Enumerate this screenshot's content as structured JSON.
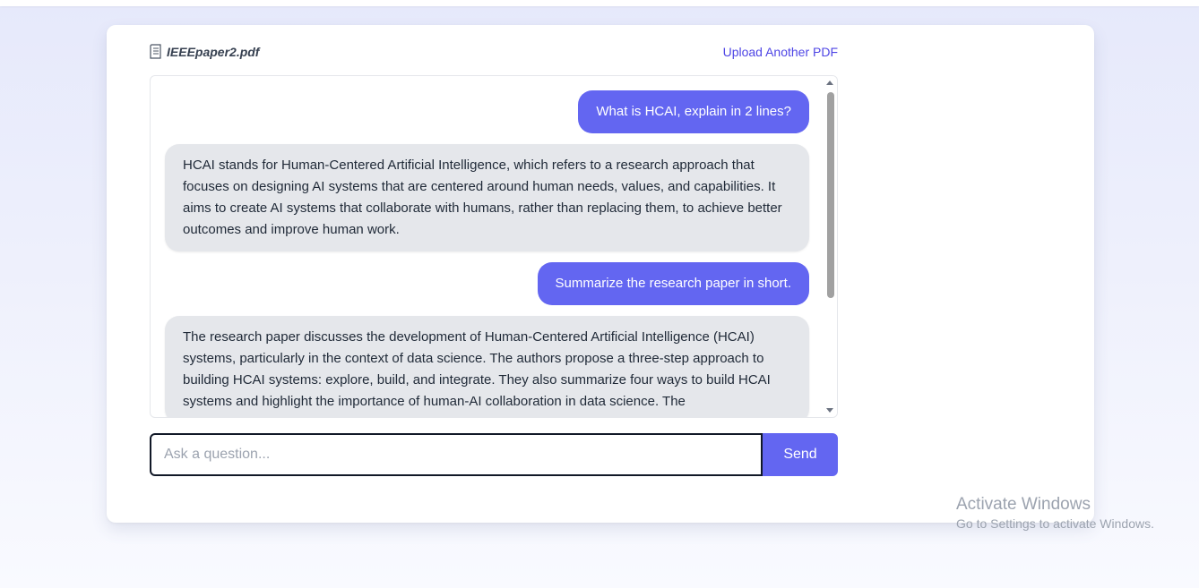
{
  "file": {
    "icon": "document-icon",
    "name": "IEEEpaper2.pdf",
    "upload_label": "Upload Another PDF"
  },
  "chat": {
    "messages": [
      {
        "role": "user",
        "text": "What is HCAI, explain in 2 lines?"
      },
      {
        "role": "assistant",
        "text": "HCAI stands for Human-Centered Artificial Intelligence, which refers to a research approach that focuses on designing AI systems that are centered around human needs, values, and capabilities. It aims to create AI systems that collaborate with humans, rather than replacing them, to achieve better outcomes and improve human work."
      },
      {
        "role": "user",
        "text": "Summarize the research paper in short."
      },
      {
        "role": "assistant",
        "text": "The research paper discusses the development of Human-Centered Artificial Intelligence (HCAI) systems, particularly in the context of data science. The authors propose a three-step approach to building HCAI systems: explore, build, and integrate. They also summarize four ways to build HCAI systems and highlight the importance of human-AI collaboration in data science. The"
      }
    ]
  },
  "input": {
    "placeholder": "Ask a question...",
    "value": "",
    "send_label": "Send"
  },
  "watermark": {
    "title": "Activate Windows",
    "subtitle": "Go to Settings to activate Windows."
  },
  "colors": {
    "accent": "#6366f1",
    "link": "#4f46e5",
    "bot_bubble": "#e5e7eb"
  }
}
